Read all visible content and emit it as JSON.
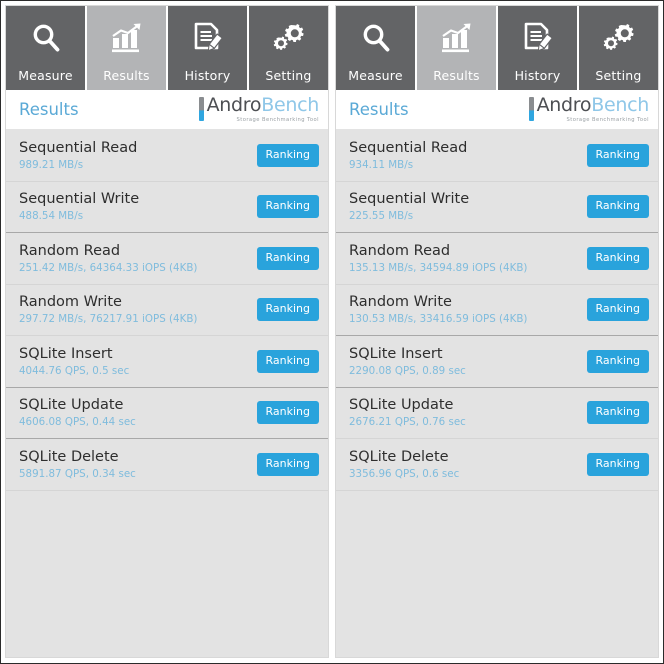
{
  "app": {
    "logo_primary": "Andro",
    "logo_secondary": "Bench",
    "logo_tagline": "Storage Benchmarking Tool",
    "accent_blue": "#29a3dc",
    "value_blue": "#7fbcdd",
    "title_blue": "#5aa9d6",
    "tab_inactive_bg": "#636466",
    "tab_active_bg": "#b3b4b6",
    "list_bg": "#e3e3e3"
  },
  "tabs": [
    {
      "label": "Measure",
      "icon": "magnifier-icon",
      "active": false
    },
    {
      "label": "Results",
      "icon": "bar-chart-icon",
      "active": true
    },
    {
      "label": "History",
      "icon": "document-pen-icon",
      "active": false
    },
    {
      "label": "Setting",
      "icon": "gears-icon",
      "active": false
    }
  ],
  "panels": [
    {
      "page_title": "Results",
      "rows": [
        {
          "title": "Sequential Read",
          "value": "989.21 MB/s",
          "button": "Ranking",
          "group_end": false
        },
        {
          "title": "Sequential Write",
          "value": "488.54 MB/s",
          "button": "Ranking",
          "group_end": true
        },
        {
          "title": "Random Read",
          "value": "251.42 MB/s, 64364.33 iOPS (4KB)",
          "button": "Ranking",
          "group_end": false
        },
        {
          "title": "Random Write",
          "value": "297.72 MB/s, 76217.91 iOPS (4KB)",
          "button": "Ranking",
          "group_end": false
        },
        {
          "title": "SQLite Insert",
          "value": "4044.76 QPS, 0.5 sec",
          "button": "Ranking",
          "group_end": true
        },
        {
          "title": "SQLite Update",
          "value": "4606.08 QPS, 0.44 sec",
          "button": "Ranking",
          "group_end": true
        },
        {
          "title": "SQLite Delete",
          "value": "5891.87 QPS, 0.34 sec",
          "button": "Ranking",
          "group_end": false
        }
      ]
    },
    {
      "page_title": "Results",
      "rows": [
        {
          "title": "Sequential Read",
          "value": "934.11 MB/s",
          "button": "Ranking",
          "group_end": false
        },
        {
          "title": "Sequential Write",
          "value": "225.55 MB/s",
          "button": "Ranking",
          "group_end": true
        },
        {
          "title": "Random Read",
          "value": "135.13 MB/s, 34594.89 iOPS (4KB)",
          "button": "Ranking",
          "group_end": false
        },
        {
          "title": "Random Write",
          "value": "130.53 MB/s, 33416.59 iOPS (4KB)",
          "button": "Ranking",
          "group_end": true
        },
        {
          "title": "SQLite Insert",
          "value": "2290.08 QPS, 0.89 sec",
          "button": "Ranking",
          "group_end": true
        },
        {
          "title": "SQLite Update",
          "value": "2676.21 QPS, 0.76 sec",
          "button": "Ranking",
          "group_end": false
        },
        {
          "title": "SQLite Delete",
          "value": "3356.96 QPS, 0.6 sec",
          "button": "Ranking",
          "group_end": false
        }
      ]
    }
  ]
}
